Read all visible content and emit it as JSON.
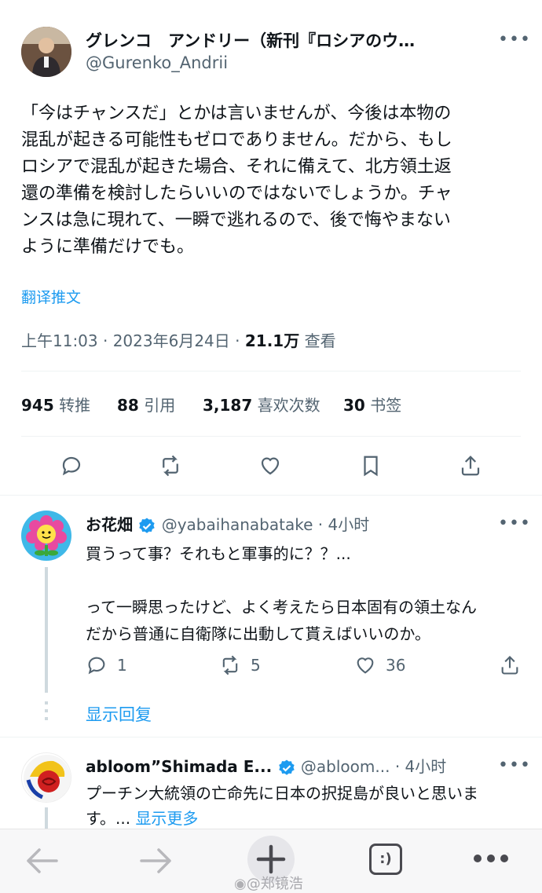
{
  "main_tweet": {
    "display_name": "グレンコ　アンドリー（新刊『ロシアのウ…",
    "handle": "@Gurenko_Andrii",
    "text_lines": [
      "「今はチャンスだ」とかは言いませんが、今後は本物の",
      "混乱が起きる可能性もゼロでありません。だから、もし",
      "ロシアで混乱が起きた場合、それに備えて、北方領土返",
      "還の準備を検討したらいいのではないでしょうか。チャ",
      "ンスは急に現れて、一瞬で逃れるので、後で悔やまない",
      "ように準備だけでも。"
    ],
    "translate_label": "翻译推文",
    "timestamp": "上午11:03 · 2023年6月24日 · ",
    "views_count": "21.1万",
    "views_label": " 查看",
    "stats": {
      "retweets": {
        "count": "945",
        "label": "转推"
      },
      "quotes": {
        "count": "88",
        "label": "引用"
      },
      "likes": {
        "count": "3,187",
        "label": "喜欢次数"
      },
      "bookmarks": {
        "count": "30",
        "label": "书签"
      }
    },
    "more_label": "•••"
  },
  "reply1": {
    "display_name": "お花畑",
    "handle": "@yabaihanabatake · 4小时",
    "text_lines": [
      "買うって事？それもと軍事的に？？...",
      "",
      "って一瞬思ったけど、よく考えたら日本固有の領土なん",
      "だから普通に自衛隊に出動して貰えばいいのか。"
    ],
    "reply_count": "1",
    "retweet_count": "5",
    "like_count": "36",
    "show_replies": "显示回复"
  },
  "reply2": {
    "display_name": "abloom”Shimada E...",
    "handle": "@abloom...",
    "time": "· 4小时",
    "text_line1": "プーチン大統領の亡命先に日本の択捉島が良いと思いま",
    "text_line2": "す。...",
    "show_more": "显示更多"
  },
  "bottom_nav": {
    "tab_count_label": ":)",
    "watermark": "@郑镜浩"
  },
  "colors": {
    "accent": "#1d9bf0",
    "text": "#0f1419",
    "muted": "#536471"
  }
}
